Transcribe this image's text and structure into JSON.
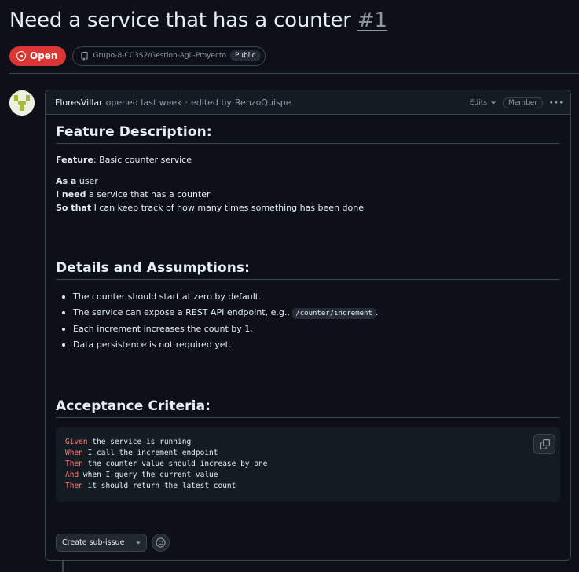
{
  "issue": {
    "title": "Need a service that has a counter",
    "number": "#1",
    "state": "Open",
    "repo": "Grupo-8-CC3S2/Gestion-Agil-Proyecto",
    "visibility": "Public"
  },
  "comment": {
    "author": "FloresVillar",
    "action": "opened last week",
    "separator": "·",
    "edited_prefix": "edited by",
    "editor": "RenzoQuispe",
    "edits_label": "Edits",
    "role_badge": "Member"
  },
  "content": {
    "section1_heading": "Feature Description:",
    "feature_label": "Feature",
    "feature_value": ": Basic counter service",
    "as_a_label": "As a",
    "as_a_value": " user",
    "i_need_label": "I need",
    "i_need_value": " a service that has a counter",
    "so_that_label": "So that",
    "so_that_value": " I can keep track of how many times something has been done",
    "section2_heading": "Details and Assumptions:",
    "bullets": {
      "b1": "The counter should start at zero by default.",
      "b2_prefix": "The service can expose a REST API endpoint, e.g., ",
      "b2_code": "/counter/increment",
      "b2_suffix": ".",
      "b3": "Each increment increases the count by 1.",
      "b4": "Data persistence is not required yet."
    },
    "section3_heading": "Acceptance Criteria:",
    "code_lines": [
      {
        "kw": "Given",
        "text": " the service is running"
      },
      {
        "kw": "When",
        "text": " I call the increment endpoint"
      },
      {
        "kw": "Then",
        "text": " the counter value should increase by one"
      },
      {
        "kw": "And",
        "text": " when I query the current value"
      },
      {
        "kw": "Then",
        "text": " it should return the latest count"
      }
    ]
  },
  "actions": {
    "create_subissue": "Create sub-issue"
  },
  "colors": {
    "background": "#0d1117",
    "open_badge": "#da3633",
    "keyword": "#ff7b72",
    "border": "#3d444d"
  },
  "icons": [
    "issue-open-icon",
    "repo-icon",
    "chevron-down-icon",
    "kebab-icon",
    "copy-icon",
    "smiley-icon",
    "identicon-avatar"
  ]
}
